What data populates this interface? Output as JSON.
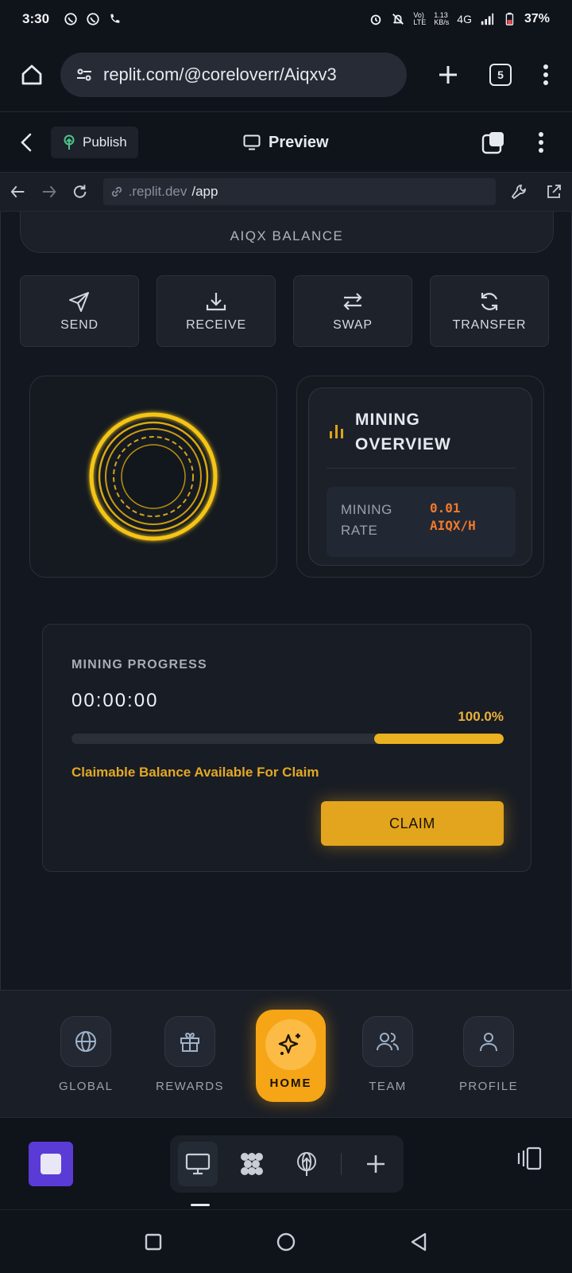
{
  "status_bar": {
    "time": "3:30",
    "net_speed": "1.13\nKB/s",
    "network": "4G",
    "battery": "37%"
  },
  "browser": {
    "url": "replit.com/@coreloverr/Aiqxv3",
    "tab_count": "5"
  },
  "replit_header": {
    "publish_label": "Publish",
    "preview_title": "Preview"
  },
  "preview_nav": {
    "host": ".replit.dev",
    "path": "/app"
  },
  "app": {
    "balance_label": "AIQX BALANCE",
    "actions": [
      {
        "label": "SEND",
        "icon": "send-icon"
      },
      {
        "label": "RECEIVE",
        "icon": "download-icon"
      },
      {
        "label": "SWAP",
        "icon": "swap-icon"
      },
      {
        "label": "TRANSFER",
        "icon": "refresh-icon"
      }
    ],
    "overview": {
      "title_line1": "MINING",
      "title_line2": "OVERVIEW",
      "rate_label_line1": "MINING",
      "rate_label_line2": "RATE",
      "rate_value_line1": "0.01",
      "rate_value_line2": "AIQX/H"
    },
    "progress": {
      "label": "MINING PROGRESS",
      "timer": "00:00:00",
      "percent_text": "100.0%",
      "fill_fraction": 0.3,
      "claimable_text": "Claimable Balance Available For Claim",
      "claim_label": "CLAIM"
    },
    "nav": [
      {
        "label": "GLOBAL",
        "icon": "globe-icon"
      },
      {
        "label": "REWARDS",
        "icon": "gift-icon"
      },
      {
        "label": "HOME",
        "icon": "sparkles-icon"
      },
      {
        "label": "TEAM",
        "icon": "users-icon"
      },
      {
        "label": "PROFILE",
        "icon": "user-icon"
      }
    ]
  },
  "colors": {
    "accent": "#e3a51d",
    "home_nav": "#f6a516",
    "rate_value": "#f07a2a",
    "stop_button": "#5b3bd6"
  }
}
